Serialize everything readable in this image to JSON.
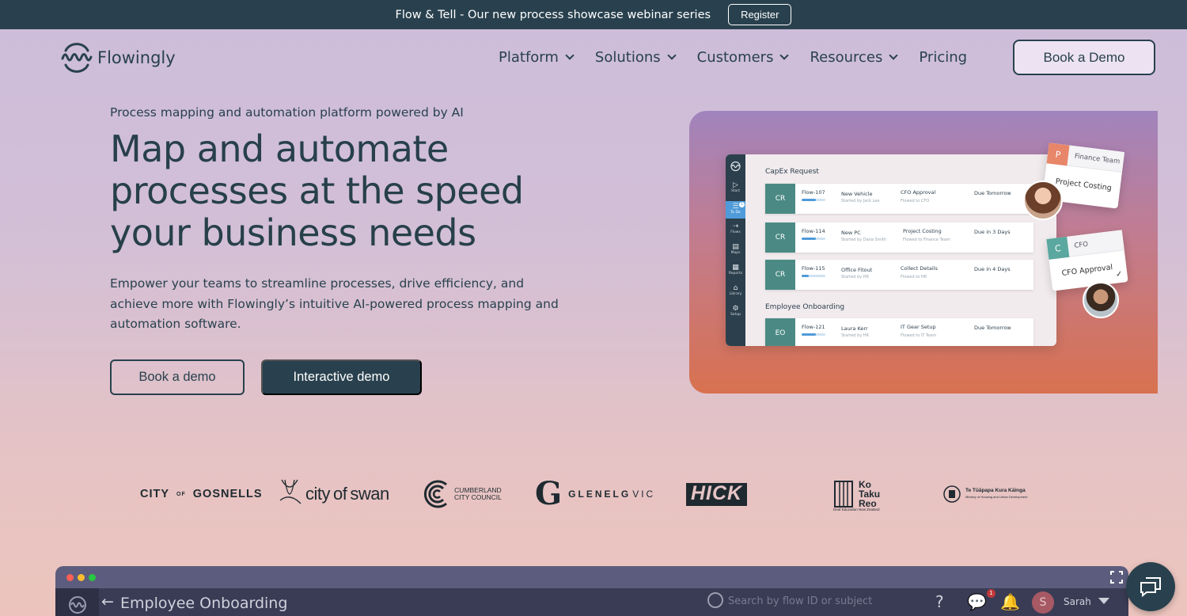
{
  "announcement": {
    "text": "Flow & Tell - Our new process showcase webinar series",
    "register_label": "Register"
  },
  "brand": {
    "name": "Flowingly"
  },
  "nav": {
    "items": [
      {
        "label": "Platform",
        "has_dropdown": true
      },
      {
        "label": "Solutions",
        "has_dropdown": true
      },
      {
        "label": "Customers",
        "has_dropdown": true
      },
      {
        "label": "Resources",
        "has_dropdown": true
      },
      {
        "label": "Pricing",
        "has_dropdown": false
      }
    ],
    "cta_label": "Book a Demo"
  },
  "hero": {
    "eyebrow": "Process mapping and automation platform powered by AI",
    "title": "Map and automate processes at the speed your business needs",
    "description": "Empower your teams to streamline processes, drive efficiency, and achieve more with Flowingly’s intuitive AI-powered process mapping and automation software.",
    "primary_button": "Book a demo",
    "secondary_button": "Interactive demo"
  },
  "app_preview": {
    "sidebar": [
      {
        "label": "Start",
        "icon": "play-icon"
      },
      {
        "label": "To Do",
        "icon": "list-icon",
        "badge": "1"
      },
      {
        "label": "Flows",
        "icon": "flows-icon"
      },
      {
        "label": "Maps",
        "icon": "document-icon"
      },
      {
        "label": "Reports",
        "icon": "table-icon"
      },
      {
        "label": "Library",
        "icon": "library-icon"
      },
      {
        "label": "Setup",
        "icon": "gear-icon"
      }
    ],
    "section_capex": "CapEx Request",
    "section_onboarding": "Employee Onboarding",
    "rows": [
      {
        "badge": "CR",
        "id": "Flow-107",
        "progress": 0.6,
        "subject": "New Vehicle",
        "started": "Started by Jack Lee",
        "step": "CFO Approval",
        "flowed": "Flowed to CFO",
        "due": "Due Tomorrow"
      },
      {
        "badge": "CR",
        "id": "Flow-114",
        "progress": 0.6,
        "subject": "New PC",
        "started": "Started by Dana Smith",
        "step": "Project Costing",
        "flowed": "Flowed to Finance Team",
        "due": "Due in 3 Days"
      },
      {
        "badge": "CR",
        "id": "Flow-115",
        "progress": 0.3,
        "subject": "Office Fitout",
        "started": "Started by HR",
        "step": "Collect Details",
        "flowed": "Flowed to HR",
        "due": "Due in 4 Days"
      },
      {
        "badge": "EO",
        "id": "Flow-121",
        "progress": 0.6,
        "subject": "Laura Kerr",
        "started": "Started by HR",
        "step": "IT Gear Setup",
        "flowed": "Flowed to IT Team",
        "due": "Due Tomorrow"
      }
    ],
    "finance_card": {
      "badge": "P",
      "team": "Finance Team",
      "task": "Project Costing"
    },
    "cfo_card": {
      "badge": "C",
      "team": "CFO",
      "task": "CFO Approval"
    }
  },
  "logos": {
    "gosnells_a": "CITY",
    "gosnells_of": "OF",
    "gosnells_b": "GOSNELLS",
    "swan_a": "city",
    "swan_of": "of",
    "swan_b": "swan",
    "cumberland_a": "CUMBERLAND",
    "cumberland_b": "CITY COUNCIL",
    "glenelg_mark": "G",
    "glenelg": "GLENELG",
    "glenelg_vic": "VIC",
    "hick": "HICK",
    "kotaku_a": "Ko",
    "kotaku_b": "Taku",
    "kotaku_c": "Reo",
    "kotaku_sub": "Deaf Education New Zealand",
    "tetuapapa": "Te Tūāpapa Kura Kāinga",
    "tetuapapa_sub": "Ministry of Housing and Urban Development"
  },
  "demo_window": {
    "title": "Employee Onboarding",
    "search_placeholder": "Search by flow ID or subject",
    "notification_count": "1",
    "user_initial": "S",
    "user_name": "Sarah"
  },
  "colors": {
    "dark": "#29414e",
    "accent_teal": "#4b8a84",
    "accent_orange": "#e07a5f",
    "progress_blue": "#4f9bd9"
  }
}
